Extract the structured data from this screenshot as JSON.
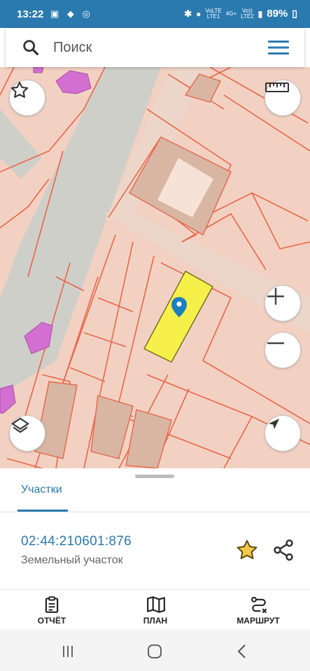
{
  "statusbar": {
    "time": "13:22",
    "net1_top": "VoLTE",
    "net1_bottom": "LTE1",
    "net2_top": "4G+",
    "net3_top": "Vo))",
    "net3_bottom": "LTE2",
    "battery": "89%"
  },
  "search": {
    "placeholder": "Поиск"
  },
  "sheet": {
    "tab_label": "Участки",
    "parcel_number": "02:44:210601:876",
    "parcel_type": "Земельный участок"
  },
  "nav": {
    "report_label": "ОТЧЁТ",
    "plan_label": "ПЛАН",
    "route_label": "МАРШРУТ"
  },
  "colors": {
    "accent": "#2a7ab0",
    "parcel_fill": "#f3d1c2",
    "parcel_border": "#e8664a",
    "selected_parcel": "#f7f04a",
    "building": "#d36fd1",
    "road": "#cfcfc9",
    "star": "#f2c94c"
  }
}
